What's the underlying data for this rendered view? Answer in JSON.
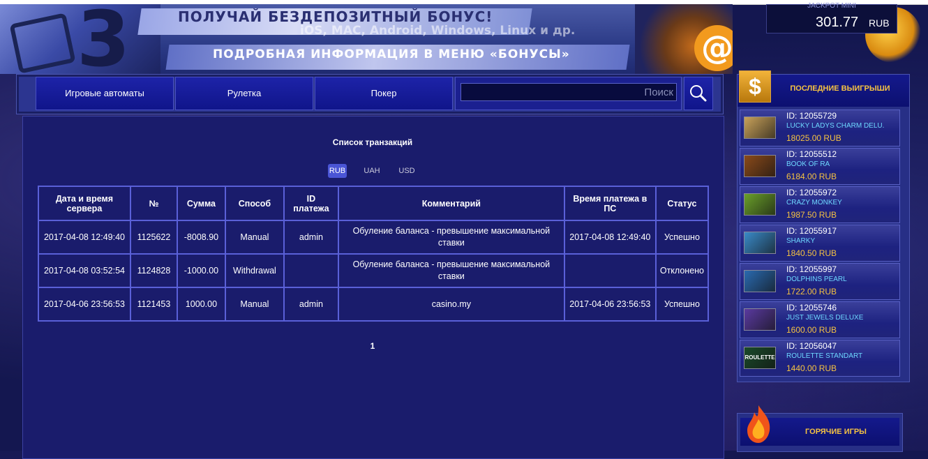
{
  "banner": {
    "line1": "ПОЛУЧАЙ БЕЗДЕПОЗИТНЫЙ БОНУС!",
    "line2": "iOS, MAC, Android, Windows, Linux и др.",
    "line3": "ПОДРОБНАЯ ИНФОРМАЦИЯ В МЕНЮ «БОНУСЫ»"
  },
  "jackpot": {
    "label": "JACKPOT MINI",
    "value": "301.77",
    "currency": "RUB"
  },
  "nav": {
    "slots": "Игровые автоматы",
    "roulette": "Рулетка",
    "poker": "Покер",
    "search_placeholder": "Поиск"
  },
  "main": {
    "title": "Список транзакций",
    "currencies": [
      "RUB",
      "UAH",
      "USD"
    ],
    "active_currency": "RUB",
    "columns": [
      "Дата и время сервера",
      "№",
      "Сумма",
      "Способ",
      "ID платежа",
      "Комментарий",
      "Время платежа в ПС",
      "Статус"
    ],
    "rows": [
      [
        "2017-04-08 12:49:40",
        "1125622",
        "-8008.90",
        "Manual",
        "admin",
        "Обуление баланса - превышение максимальной ставки",
        "2017-04-08 12:49:40",
        "Успешно"
      ],
      [
        "2017-04-08 03:52:54",
        "1124828",
        "-1000.00",
        "Withdrawal",
        "",
        "Обуление баланса - превышение максимальной ставки",
        "",
        "Отклонено"
      ],
      [
        "2017-04-06 23:56:53",
        "1121453",
        "1000.00",
        "Manual",
        "admin",
        "casino.my",
        "2017-04-06 23:56:53",
        "Успешно"
      ]
    ],
    "page": "1"
  },
  "sidebar": {
    "title": "ПОСЛЕДНИЕ ВЫИГРЫШИ",
    "wins": [
      {
        "id": "ID: 12055729",
        "game": "LUCKY LADYS CHARM DELU.",
        "amount": "18025.00 RUB",
        "color": "#c9a25a"
      },
      {
        "id": "ID: 12055512",
        "game": "BOOK OF RA",
        "amount": "6184.00 RUB",
        "color": "#8a4a1a"
      },
      {
        "id": "ID: 12055972",
        "game": "CRAZY MONKEY",
        "amount": "1987.50 RUB",
        "color": "#6aa02a"
      },
      {
        "id": "ID: 12055917",
        "game": "SHARKY",
        "amount": "1840.50 RUB",
        "color": "#3a8ac8"
      },
      {
        "id": "ID: 12055997",
        "game": "DOLPHINS PEARL",
        "amount": "1722.00 RUB",
        "color": "#2a6ab0"
      },
      {
        "id": "ID: 12055746",
        "game": "JUST JEWELS DELUXE",
        "amount": "1600.00 RUB",
        "color": "#5a3aa0"
      },
      {
        "id": "ID: 12056047",
        "game": "ROULETTE STANDART",
        "amount": "1440.00 RUB",
        "color": "#1a4a2a",
        "thumb_text": "ROULETTE"
      }
    ]
  },
  "hot": {
    "title": "ГОРЯЧИЕ ИГРЫ"
  }
}
